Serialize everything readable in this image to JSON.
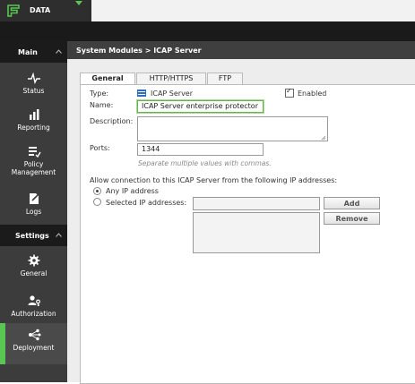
{
  "brand": {
    "label": "DATA",
    "color": "#59c653"
  },
  "sidebar": {
    "sections": [
      {
        "label": "Main"
      },
      {
        "label": "Settings"
      }
    ],
    "items": [
      {
        "label": "Status",
        "icon": "pulse-icon"
      },
      {
        "label": "Reporting",
        "icon": "bar-chart-icon"
      },
      {
        "label": "Policy Management",
        "label1": "Policy",
        "label2": "Management",
        "icon": "policy-list-icon"
      },
      {
        "label": "Logs",
        "icon": "document-pencil-icon"
      },
      {
        "label": "General",
        "icon": "gear-icon"
      },
      {
        "label": "Authorization",
        "icon": "users-key-icon"
      },
      {
        "label": "Deployment",
        "icon": "network-icon",
        "active": true
      }
    ]
  },
  "header": {
    "breadcrumb": "System Modules > ICAP Server"
  },
  "tabs": [
    {
      "label": "General",
      "active": true
    },
    {
      "label": "HTTP/HTTPS"
    },
    {
      "label": "FTP"
    }
  ],
  "form": {
    "type_label": "Type:",
    "type_value": "ICAP Server",
    "enabled_label": "Enabled",
    "enabled_checked": true,
    "name_label": "Name:",
    "name_value": "ICAP Server enterprise protector",
    "description_label": "Description:",
    "description_value": "",
    "ports_label": "Ports:",
    "ports_value": "1344",
    "ports_hint": "Separate multiple values with commas.",
    "allow_label": "Allow connection to this ICAP Server from the following IP addresses:",
    "radio_any": "Any IP address",
    "radio_selected": "Selected IP addresses:",
    "selected_option": "any",
    "ip_input_value": "",
    "add_button": "Add",
    "remove_button": "Remove"
  }
}
